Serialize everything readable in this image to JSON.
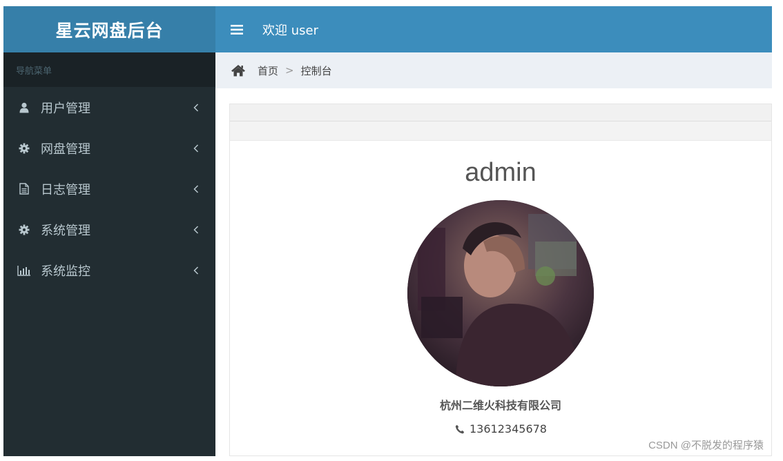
{
  "app": {
    "logo_text": "星云网盘后台"
  },
  "header": {
    "welcome_text": "欢迎 user"
  },
  "sidebar": {
    "header_label": "导航菜单",
    "items": [
      {
        "label": "用户管理",
        "icon": "user-icon"
      },
      {
        "label": "网盘管理",
        "icon": "gear-icon"
      },
      {
        "label": "日志管理",
        "icon": "document-icon"
      },
      {
        "label": "系统管理",
        "icon": "gear-icon"
      },
      {
        "label": "系统监控",
        "icon": "bar-chart-icon"
      }
    ]
  },
  "breadcrumb": {
    "home": "首页",
    "separator": ">",
    "current": "控制台"
  },
  "profile": {
    "username": "admin",
    "company": "杭州二维火科技有限公司",
    "phone": "13612345678"
  },
  "watermark": "CSDN @不脱发的程序猿",
  "colors": {
    "sidebar_bg": "#222d32",
    "logo_bg": "#367fa9",
    "header_bg": "#3c8dbc",
    "breadcrumb_bg": "#ecf0f5"
  }
}
